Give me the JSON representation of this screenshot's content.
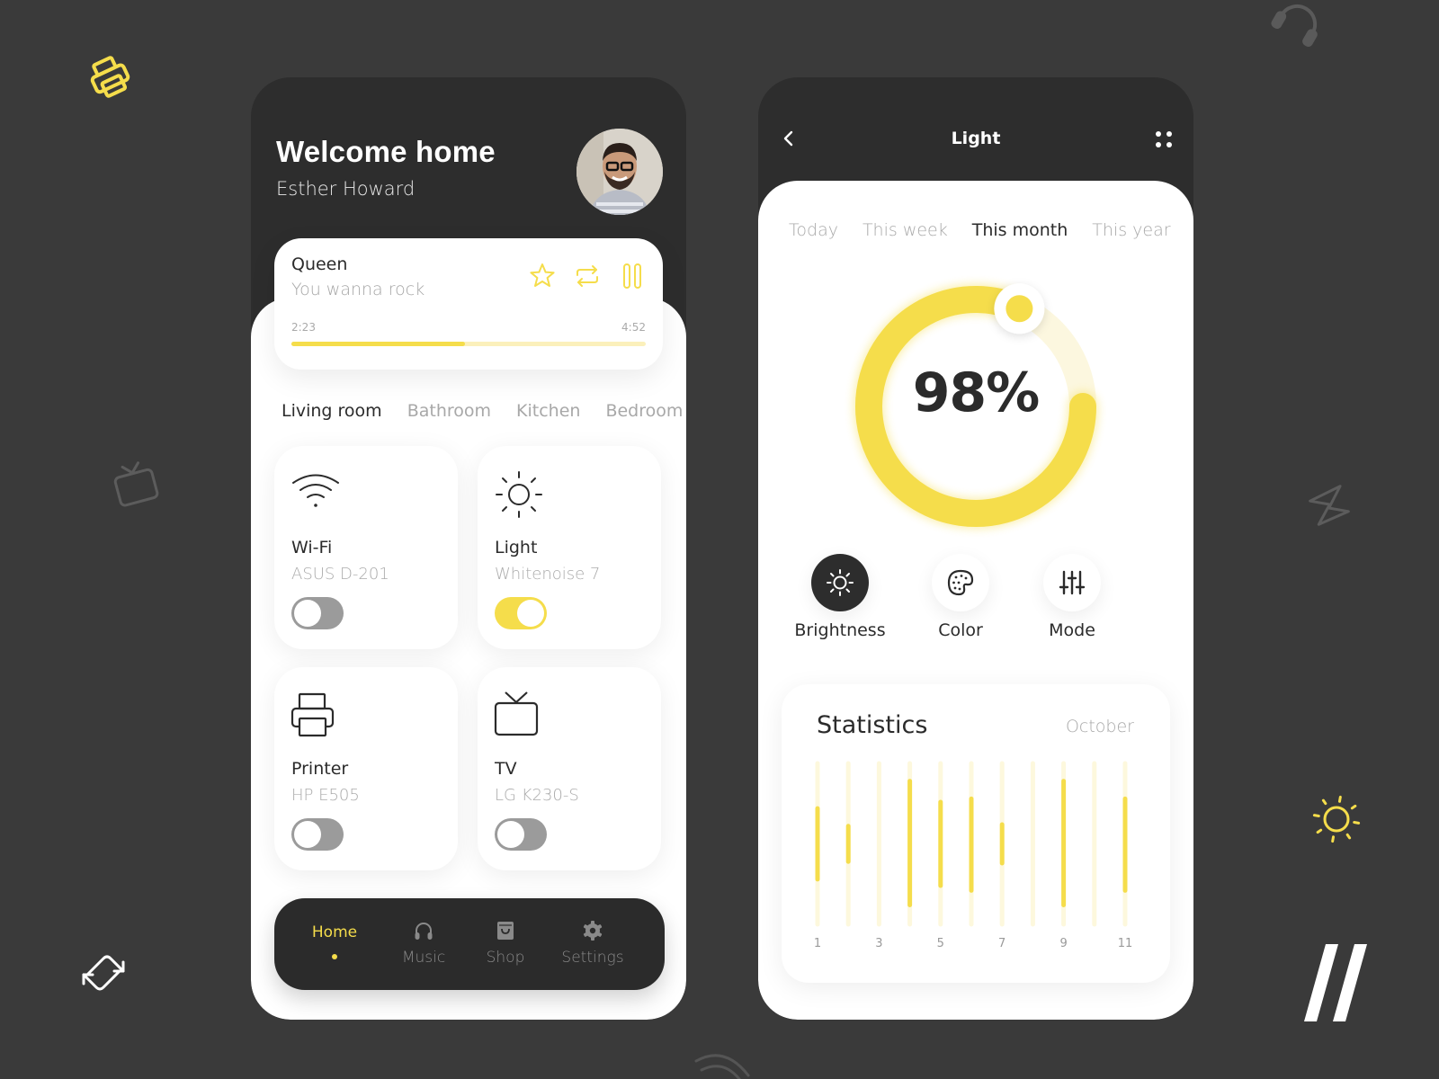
{
  "colors": {
    "accent": "#f5dd4b",
    "accent_light": "#fdf8dd",
    "dark": "#2d2d2d",
    "background": "#3a3a3a",
    "muted_text": "#a8a8a8"
  },
  "home": {
    "greeting": "Welcome home",
    "user_name": "Esther Howard",
    "player": {
      "artist": "Queen",
      "song": "You wanna rock",
      "elapsed": "2:23",
      "duration": "4:52",
      "progress": 0.49,
      "icons": [
        "star-icon",
        "repeat-icon",
        "pause-icon"
      ]
    },
    "rooms": [
      {
        "label": "Living room",
        "active": true
      },
      {
        "label": "Bathroom",
        "active": false
      },
      {
        "label": "Kitchen",
        "active": false
      },
      {
        "label": "Bedroom",
        "active": false
      }
    ],
    "devices": [
      {
        "name": "Wi-Fi",
        "model": "ASUS D-201",
        "on": false,
        "icon": "wifi-icon"
      },
      {
        "name": "Light",
        "model": "Whitenoise 7",
        "on": true,
        "icon": "sun-icon"
      },
      {
        "name": "Printer",
        "model": "HP E505",
        "on": false,
        "icon": "printer-icon"
      },
      {
        "name": "TV",
        "model": "LG K230-S",
        "on": false,
        "icon": "tv-icon"
      }
    ],
    "nav": [
      {
        "label": "Home",
        "active": true,
        "icon": "home-icon"
      },
      {
        "label": "Music",
        "active": false,
        "icon": "headphones-icon"
      },
      {
        "label": "Shop",
        "active": false,
        "icon": "shopping-bag-icon"
      },
      {
        "label": "Settings",
        "active": false,
        "icon": "gear-icon"
      }
    ]
  },
  "light": {
    "title": "Light",
    "periods": [
      {
        "label": "Today",
        "active": false
      },
      {
        "label": "This week",
        "active": false
      },
      {
        "label": "This month",
        "active": true
      },
      {
        "label": "This year",
        "active": false
      }
    ],
    "level_text": "98%",
    "level": 0.98,
    "modes": [
      {
        "label": "Brightness",
        "active": true,
        "icon": "sun-icon"
      },
      {
        "label": "Color",
        "active": false,
        "icon": "palette-icon"
      },
      {
        "label": "Mode",
        "active": false,
        "icon": "sliders-icon"
      }
    ],
    "statistics": {
      "title": "Statistics",
      "month": "October"
    }
  },
  "chart_data": {
    "type": "bar",
    "title": "Statistics",
    "subtitle": "October",
    "x": [
      1,
      2,
      3,
      4,
      5,
      6,
      7,
      8,
      9,
      10,
      11
    ],
    "tick_labels": [
      "1",
      "3",
      "5",
      "7",
      "9",
      "11"
    ],
    "ranges": [
      [
        0.28,
        0.72
      ],
      [
        0.39,
        0.61
      ],
      null,
      [
        0.11,
        0.88
      ],
      [
        0.24,
        0.76
      ],
      [
        0.22,
        0.79
      ],
      [
        0.38,
        0.62
      ],
      null,
      [
        0.11,
        0.88
      ],
      null,
      [
        0.22,
        0.79
      ]
    ],
    "ylim": [
      0,
      1
    ],
    "grid": false,
    "legend": "none"
  }
}
